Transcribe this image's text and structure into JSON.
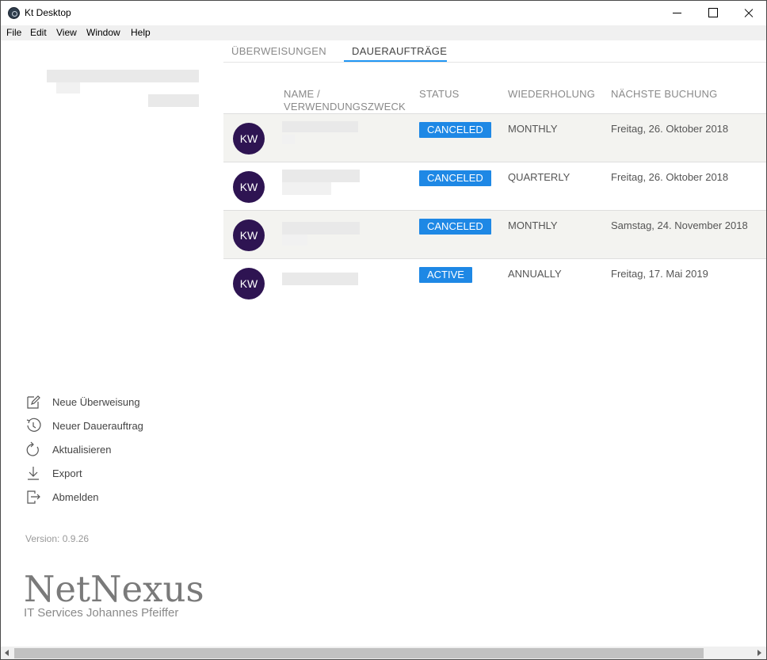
{
  "window": {
    "title": "Kt Desktop"
  },
  "menu": [
    "File",
    "Edit",
    "View",
    "Window",
    "Help"
  ],
  "tabs": [
    {
      "label": "ÜBERWEISUNGEN",
      "active": false
    },
    {
      "label": "DAUERAUFTRÄGE",
      "active": true
    }
  ],
  "table": {
    "headers": [
      "NAME /",
      "VERWENDUNGSZWECK",
      "STATUS",
      "WIEDERHOLUNG",
      "NÄCHSTE BUCHUNG"
    ],
    "rows": [
      {
        "initials": "KW",
        "status": "CANCELED",
        "repeat": "MONTHLY",
        "next": "Freitag, 26. Oktober 2018"
      },
      {
        "initials": "KW",
        "status": "CANCELED",
        "repeat": "QUARTERLY",
        "next": "Freitag, 26. Oktober 2018"
      },
      {
        "initials": "KW",
        "status": "CANCELED",
        "repeat": "MONTHLY",
        "next": "Samstag, 24. November 2018"
      },
      {
        "initials": "KW",
        "status": "ACTIVE",
        "repeat": "ANNUALLY",
        "next": "Freitag, 17. Mai 2019"
      }
    ]
  },
  "sidebar": {
    "actions": [
      {
        "label": "Neue Überweisung",
        "icon": "edit-icon"
      },
      {
        "label": "Neuer Dauerauftrag",
        "icon": "clock-icon"
      },
      {
        "label": "Aktualisieren",
        "icon": "refresh-icon"
      },
      {
        "label": "Export",
        "icon": "download-icon"
      },
      {
        "label": "Abmelden",
        "icon": "logout-icon"
      }
    ],
    "version": "Version: 0.9.26"
  },
  "logo": {
    "main": "NetNexus",
    "sub": "IT Services  Johannes Pfeiffer"
  },
  "colors": {
    "accent": "#2196f3",
    "badge": "#1e88e5",
    "avatar": "#2e1452"
  }
}
